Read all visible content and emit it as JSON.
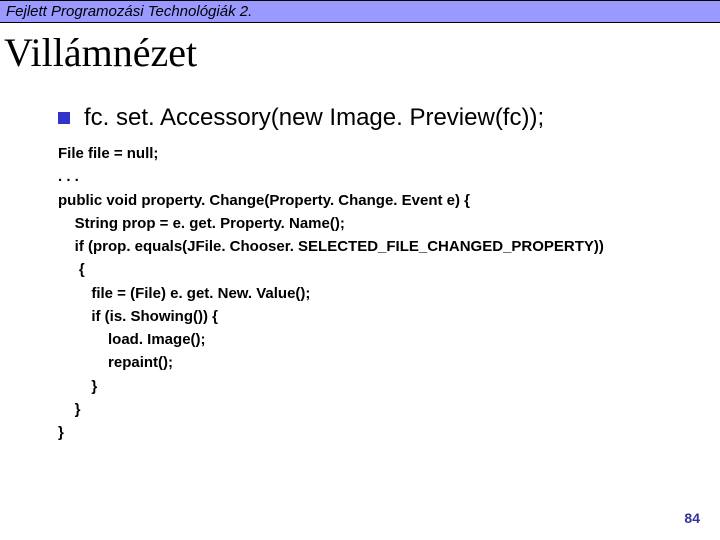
{
  "header": {
    "text": "Fejlett Programozási Technológiák 2."
  },
  "title": "Villámnézet",
  "bullet": "fc. set. Accessory(new Image. Preview(fc));",
  "code": "File file = null;\n. . .\npublic void property. Change(Property. Change. Event e) {\n    String prop = e. get. Property. Name();\n    if (prop. equals(JFile. Chooser. SELECTED_FILE_CHANGED_PROPERTY))\n     {\n        file = (File) e. get. New. Value();\n        if (is. Showing()) {\n            load. Image();\n            repaint();\n        }\n    }\n}",
  "page_number": "84"
}
